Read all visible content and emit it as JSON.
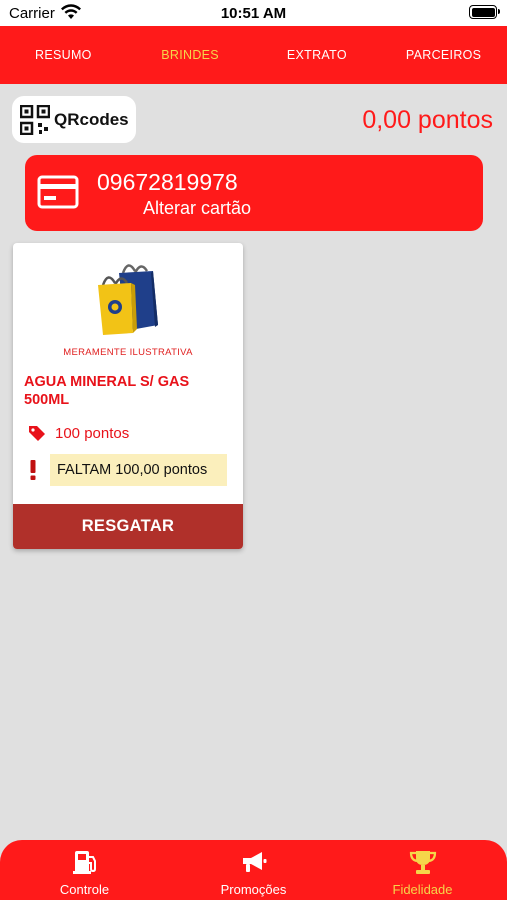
{
  "status_bar": {
    "carrier": "Carrier",
    "time": "10:51 AM"
  },
  "top_tabs": [
    {
      "label": "RESUMO",
      "active": false
    },
    {
      "label": "BRINDES",
      "active": true
    },
    {
      "label": "EXTRATO",
      "active": false
    },
    {
      "label": "PARCEIROS",
      "active": false
    }
  ],
  "qr_button": {
    "label": "QRcodes",
    "icon": "qr-code-icon"
  },
  "points": {
    "total": "0,00 pontos"
  },
  "card": {
    "number": "09672819978",
    "change_label": "Alterar cartão",
    "icon": "credit-card-icon"
  },
  "rewards": [
    {
      "image_caption": "MERAMENTE ILUSTRATIVA",
      "name": "AGUA MINERAL S/ GAS 500ML",
      "cost": "100 pontos",
      "missing": "FALTAM 100,00 pontos",
      "redeem_label": "RESGATAR"
    }
  ],
  "bottom_nav": [
    {
      "label": "Controle",
      "icon": "fuel-pump-icon",
      "active": false
    },
    {
      "label": "Promoções",
      "icon": "megaphone-icon",
      "active": false
    },
    {
      "label": "Fidelidade",
      "icon": "trophy-icon",
      "active": true
    }
  ],
  "colors": {
    "brand_red": "#ff1a1a",
    "active_yellow": "#f5d54a",
    "redeem_button": "#b0302a",
    "warning_bg": "#fbefbc"
  }
}
